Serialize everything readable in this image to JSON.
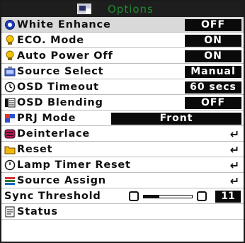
{
  "title": "Options",
  "rows": [
    {
      "label": "White Enhance",
      "value": "OFF",
      "icon": "white-enhance-icon"
    },
    {
      "label": "ECO. Mode",
      "value": "ON",
      "icon": "eco-bulb-icon"
    },
    {
      "label": "Auto Power Off",
      "value": "ON",
      "icon": "power-bulb-icon"
    },
    {
      "label": "Source Select",
      "value": "Manual",
      "icon": "source-select-icon"
    },
    {
      "label": "OSD Timeout",
      "value": "60 secs",
      "icon": "clock-icon"
    },
    {
      "label": "OSD Blending",
      "value": "OFF",
      "icon": "osd-blending-icon"
    },
    {
      "label": "PRJ Mode",
      "value": "Front",
      "icon": "prj-mode-icon"
    },
    {
      "label": "Deinterlace",
      "value": "↵",
      "icon": "deinterlace-icon"
    },
    {
      "label": "Reset",
      "value": "↵",
      "icon": "folder-reset-icon"
    },
    {
      "label": "Lamp Timer Reset",
      "value": "↵",
      "icon": "lamp-timer-icon"
    },
    {
      "label": "Source Assign",
      "value": "↵",
      "icon": "source-assign-icon"
    },
    {
      "label": "Sync Threshold",
      "value": "11",
      "icon": ""
    },
    {
      "label": "Status",
      "value": "",
      "icon": "status-document-icon"
    }
  ],
  "sync_threshold_level": 0.33
}
